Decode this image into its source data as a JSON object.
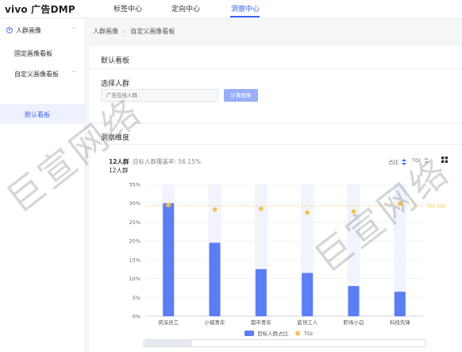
{
  "header": {
    "logo": "vivo 广告DMP",
    "tabs": [
      {
        "label": "标签中心",
        "active": false
      },
      {
        "label": "定向中心",
        "active": false
      },
      {
        "label": "洞察中心",
        "active": true
      }
    ]
  },
  "sidebar": {
    "group_label": "人群画像",
    "items": [
      {
        "label": "固定画像看板"
      },
      {
        "label": "自定义画像看板"
      }
    ],
    "sub_items": [
      {
        "label": "默认看板",
        "active": true
      }
    ]
  },
  "breadcrumb": [
    "人群画像",
    "自定义画像看板"
  ],
  "default_board": {
    "title": "默认看板",
    "select_label": "选择人群",
    "input_placeholder": "广告在线人群",
    "calc_button": "计算画像"
  },
  "insight": {
    "title": "洞察维度",
    "crowd_count": "12人群",
    "coverage_text": "目标人群覆盖率: 56.15%",
    "crowd_count_sub": "12人群",
    "sort_label": "占比",
    "tgi_label": "TGI"
  },
  "chart_data": {
    "type": "bar",
    "categories": [
      "资深员工",
      "小城青年",
      "都市青年",
      "蓝领工人",
      "职场小白",
      "科技先锋"
    ],
    "series": [
      {
        "name": "目标人群占比",
        "type": "bar",
        "values": [
          30.0,
          19.5,
          12.5,
          11.5,
          8.0,
          6.5
        ],
        "color": "#5b7ef5"
      },
      {
        "name": "TGI",
        "type": "scatter",
        "values": [
          29.5,
          28.3,
          28.5,
          27.5,
          27.8,
          29.9
        ],
        "color": "#f5c04c"
      }
    ],
    "yticks": [
      "0%",
      "5%",
      "10%",
      "15%",
      "20%",
      "25%",
      "30%",
      "35%"
    ],
    "ylim": [
      0,
      35
    ],
    "reference_line": {
      "label": "TGI 100",
      "value": 29.3,
      "color": "#f5c04c"
    },
    "legend": [
      "目标人群占比",
      "TGI"
    ],
    "legend_position": "bottom"
  },
  "watermark": "巨宣网络",
  "colors": {
    "accent": "#3a62f1",
    "bar": "#5b7ef5",
    "tgi": "#f5c04c"
  }
}
